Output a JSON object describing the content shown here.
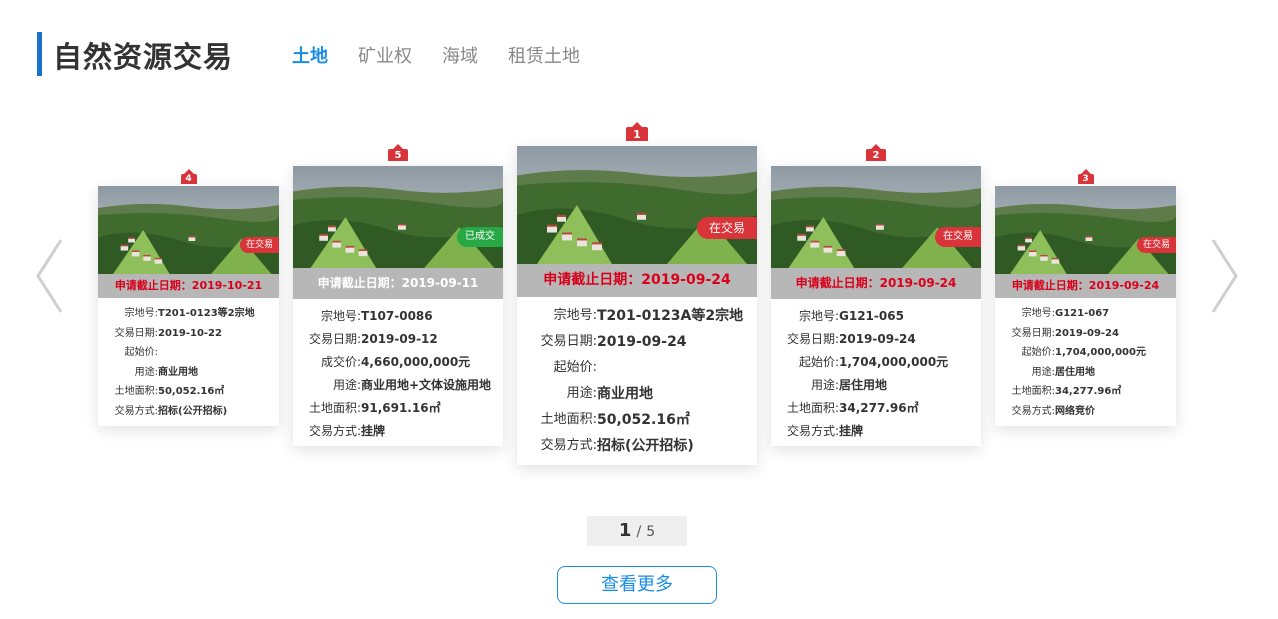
{
  "header": {
    "title": "自然资源交易",
    "tabs": [
      {
        "label": "土地",
        "active": true
      },
      {
        "label": "矿业权",
        "active": false
      },
      {
        "label": "海域",
        "active": false
      },
      {
        "label": "租赁土地",
        "active": false
      }
    ]
  },
  "labels": {
    "code": "宗地号:",
    "date": "交易日期:",
    "start_price": "起始价:",
    "deal_price": "成交价:",
    "usage": "用途:",
    "area": "土地面积:",
    "method": "交易方式:"
  },
  "cards": [
    {
      "index": "4",
      "status": "在交易",
      "status_color": "#d9343a",
      "deadline": "申请截止日期：2019-10-21",
      "code": "T201-0123等2宗地",
      "date": "2019-10-22",
      "price": "",
      "usage": "商业用地",
      "area": "50,052.16㎡",
      "method": "招标(公开招标)"
    },
    {
      "index": "5",
      "status": "已成交",
      "status_color": "#28a745",
      "deadline": "申请截止日期：2019-09-11",
      "code": "T107-0086",
      "date": "2019-09-12",
      "price": "4,660,000,000元",
      "usage": "商业用地+文体设施用地",
      "area": "91,691.16㎡",
      "method": "挂牌"
    },
    {
      "index": "1",
      "status": "在交易",
      "status_color": "#d9343a",
      "deadline": "申请截止日期：2019-09-24",
      "code": "T201-0123A等2宗地",
      "date": "2019-09-24",
      "price": "",
      "usage": "商业用地",
      "area": "50,052.16㎡",
      "method": "招标(公开招标)"
    },
    {
      "index": "2",
      "status": "在交易",
      "status_color": "#d9343a",
      "deadline": "申请截止日期：2019-09-24",
      "code": "G121-065",
      "date": "2019-09-24",
      "price": "1,704,000,000元",
      "usage": "居住用地",
      "area": "34,277.96㎡",
      "method": "挂牌"
    },
    {
      "index": "3",
      "status": "在交易",
      "status_color": "#d9343a",
      "deadline": "申请截止日期：2019-09-24",
      "code": "G121-067",
      "date": "2019-09-24",
      "price": "1,704,000,000元",
      "usage": "居住用地",
      "area": "34,277.96㎡",
      "method": "网络竞价"
    }
  ],
  "pager": {
    "current": "1",
    "separator": "/",
    "total": "5"
  },
  "more_button": "查看更多",
  "icons": {
    "prev": "chevron-left-icon",
    "next": "chevron-right-icon"
  },
  "colors": {
    "accent": "#1a8ee6",
    "brand_bar": "#1a73c8",
    "trading": "#d9343a",
    "done": "#28a745",
    "deadline_text": "#d9001b"
  }
}
